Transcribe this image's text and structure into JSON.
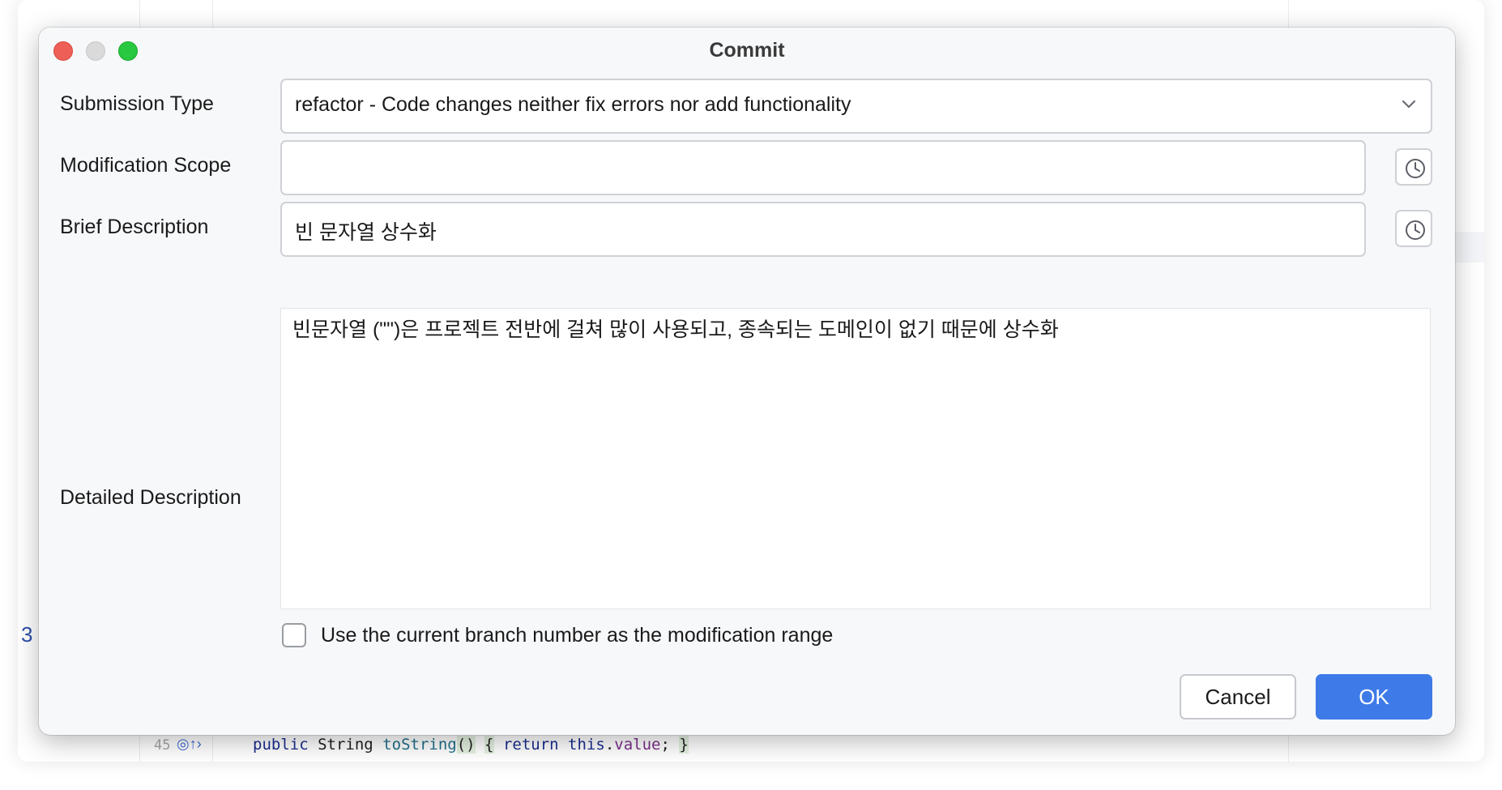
{
  "editor": {
    "gutter_line_number": "45",
    "side_marker": "3",
    "code_line": {
      "kw_public": "public",
      "type": "String",
      "method": "toString",
      "paren": "()",
      "brace_open": "{",
      "kw_return": "return",
      "kw_this": "this",
      "dot": ".",
      "field": "value",
      "semicolon": ";",
      "brace_close": "}"
    }
  },
  "dialog": {
    "title": "Commit",
    "submission_type": {
      "label": "Submission Type",
      "value": "refactor - Code changes neither fix errors nor add functionality"
    },
    "modification_scope": {
      "label": "Modification Scope",
      "value": ""
    },
    "brief_description": {
      "label": "Brief Description",
      "value": "빈 문자열 상수화"
    },
    "detailed_description": {
      "label": "Detailed Description",
      "value": "빈문자열 (\"\")은 프로젝트 전반에 걸쳐 많이 사용되고, 종속되는 도메인이 없기 때문에 상수화"
    },
    "use_branch_checkbox": {
      "label": "Use the current branch number as the modification range",
      "checked": false
    },
    "buttons": {
      "cancel": "Cancel",
      "ok": "OK"
    }
  },
  "colors": {
    "accent": "#3f7be8",
    "close": "#ee5f57",
    "minimize": "#dadada",
    "maximize": "#28c840"
  },
  "icons": {
    "history": "clock-icon",
    "dropdown": "chevron-down-icon",
    "override": "override-icon"
  }
}
